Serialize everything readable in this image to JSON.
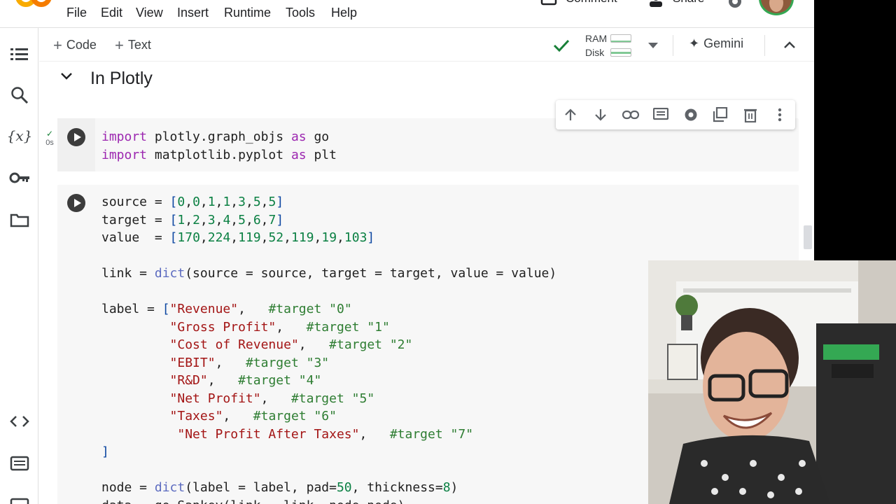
{
  "menu": {
    "items": [
      "File",
      "Edit",
      "View",
      "Insert",
      "Runtime",
      "Tools",
      "Help"
    ],
    "right_partial": [
      "Comment",
      "Share"
    ]
  },
  "toolbar": {
    "code_label": "Code",
    "text_label": "Text",
    "ram_label": "RAM",
    "disk_label": "Disk",
    "gemini_label": "Gemini"
  },
  "section": {
    "title": "In Plotly"
  },
  "cells": {
    "cell1": {
      "status": "0s",
      "lines": [
        "import plotly.graph_objs as go",
        "import matplotlib.pyplot as plt"
      ]
    },
    "cell2": {
      "lines": [
        "source = [0,0,1,1,3,5,5]",
        "target = [1,2,3,4,5,6,7]",
        "value  = [170,224,119,52,119,19,103]",
        "",
        "link = dict(source = source, target = target, value = value)",
        "",
        "label = [\"Revenue\",   #target \"0\"",
        "         \"Gross Profit\",   #target \"1\"",
        "         \"Cost of Revenue\",   #target \"2\"",
        "         \"EBIT\",   #target \"3\"",
        "         \"R&D\",   #target \"4\"",
        "         \"Net Profit\",   #target \"5\"",
        "         \"Taxes\",   #target \"6\"",
        "          \"Net Profit After Taxes\",   #target \"7\"",
        "]",
        "",
        "node = dict(label = label, pad=50, thickness=8)",
        "data = go.Sankey(link = link, node=node)"
      ]
    }
  },
  "colors": {
    "accent_green": "#188038",
    "keyword": "#9c27b0",
    "comment": "#2e7d32",
    "number": "#0b8043"
  }
}
